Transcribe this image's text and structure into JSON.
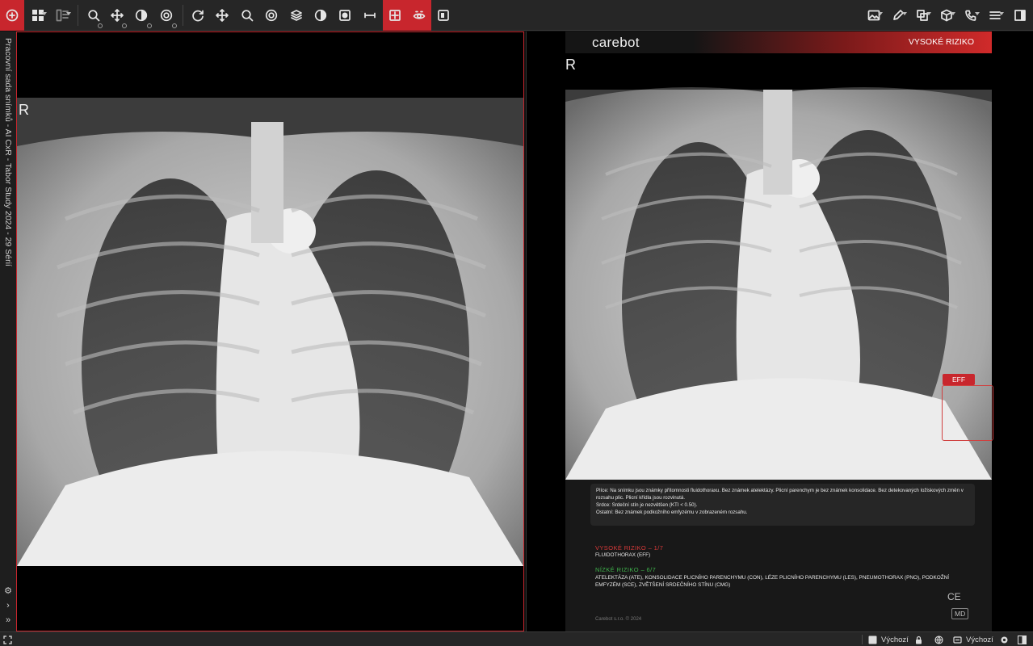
{
  "toolbar": {
    "left_tools": [
      "add-icon",
      "layout-grid-icon",
      "series-layout-icon",
      "zoom-icon",
      "pan-icon",
      "window-level-icon",
      "preset-icon",
      "rotate-icon",
      "move-icon",
      "magnify-icon",
      "preset-2-icon",
      "stack-icon",
      "contrast-icon",
      "invert-icon",
      "measure-icon",
      "ai-overlay-icon",
      "eye-overlay-icon",
      "compare-icon"
    ],
    "right_tools": [
      "image-icon",
      "pencil-icon",
      "copy-icon",
      "cube-icon",
      "phone-icon",
      "menu-icon",
      "panel-icon"
    ],
    "accent": "#c8262d"
  },
  "sidebar": {
    "title": "Pracovní sada snímků - AI CxR - Tabor Study 2024 - 29 Sérií"
  },
  "viewport_left": {
    "orientation": "R"
  },
  "viewport_right": {
    "orientation": "R",
    "report": {
      "brand": "carebot",
      "risk_label": "VYSOKÉ RIZIKO",
      "finding_tag": "EFF",
      "findings": [
        "Plíce: Na snímku jsou známky přítomnosti fluidothoraxu. Bez známek atelektázy. Plicní parenchym je bez známek konsolidace. Bez detekovaných ložiskových změn v rozsahu plic. Plicní křídla jsou rozvinutá.",
        "Srdce: Srdeční stín je nezvětšen (KTI < 0.50).",
        "Ostatní: Bez známek podkožního emfyzému v zobrazeném rozsahu."
      ],
      "high_risk_title": "VYSOKÉ RIZIKO – 1/7",
      "high_risk_items": "FLUIDOTHORAX (EFF)",
      "low_risk_title": "NÍZKÉ RIZIKO – 6/7",
      "low_risk_items": "ATELEKTÁZA (ATE), KONSOLIDACE PLICNÍHO PARENCHYMU (CON), LÉZE PLICNÍHO PARENCHYMU (LES), PNEUMOTHORAX (PNO), PODKOŽNÍ EMFYZÉM (SCE), ZVĚTŠENÍ SRDEČNÍHO STÍNU (CMG)",
      "ce_mark": "CE",
      "md_mark": "MD",
      "copyright": "Carebot s.r.o.   © 2024",
      "colors": {
        "high": "#d83a3a",
        "low": "#3fb24c"
      }
    }
  },
  "statusbar": {
    "left_icon": "fullscreen-icon",
    "layout_label": "Výchozí",
    "profile_label": "Výchozí"
  }
}
